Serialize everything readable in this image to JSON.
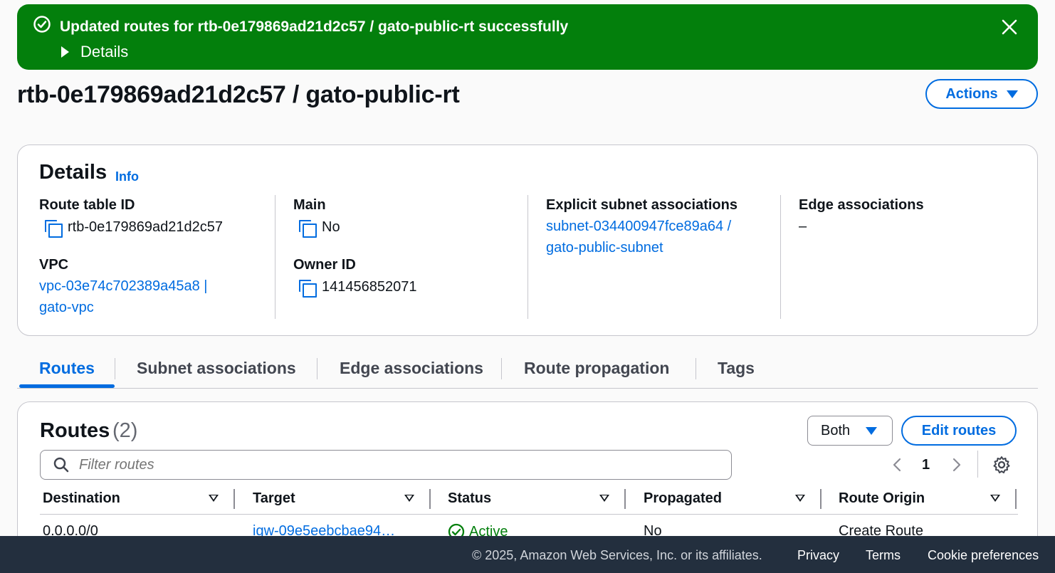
{
  "flash": {
    "message": "Updated routes for rtb-0e179869ad21d2c57 / gato-public-rt successfully",
    "details_label": "Details",
    "color": "#037f0c"
  },
  "header": {
    "title": "rtb-0e179869ad21d2c57 / gato-public-rt",
    "actions_label": "Actions"
  },
  "details": {
    "title": "Details",
    "info_label": "Info",
    "route_table_id_label": "Route table ID",
    "route_table_id": "rtb-0e179869ad21d2c57",
    "main_label": "Main",
    "main": "No",
    "explicit_label": "Explicit subnet associations",
    "explicit_line1": "subnet-034400947fce89a64 /",
    "explicit_line2": "gato-public-subnet",
    "edge_label": "Edge associations",
    "edge": "–",
    "vpc_label": "VPC",
    "vpc_line1": "vpc-03e74c702389a45a8 |",
    "vpc_line2": "gato-vpc",
    "owner_label": "Owner ID",
    "owner": "141456852071"
  },
  "tabs": [
    {
      "label": "Routes"
    },
    {
      "label": "Subnet associations"
    },
    {
      "label": "Edge associations"
    },
    {
      "label": "Route propagation"
    },
    {
      "label": "Tags"
    }
  ],
  "routes": {
    "title": "Routes",
    "count": "(2)",
    "filter_value": "Both",
    "edit_label": "Edit routes",
    "filter_placeholder": "Filter routes",
    "page": "1",
    "columns": [
      "Destination",
      "Target",
      "Status",
      "Propagated",
      "Route Origin"
    ],
    "rows": [
      {
        "destination": "0.0.0.0/0",
        "target": "igw-09e5eebcbae94…",
        "status": "Active",
        "propagated": "No",
        "origin": "Create Route"
      }
    ]
  },
  "footer": {
    "copyright": "© 2025, Amazon Web Services, Inc. or its affiliates.",
    "privacy": "Privacy",
    "terms": "Terms",
    "cookies": "Cookie preferences"
  },
  "colors": {
    "accent": "#006ce0",
    "success": "#037f0c",
    "footer_bg": "#232f3e"
  }
}
